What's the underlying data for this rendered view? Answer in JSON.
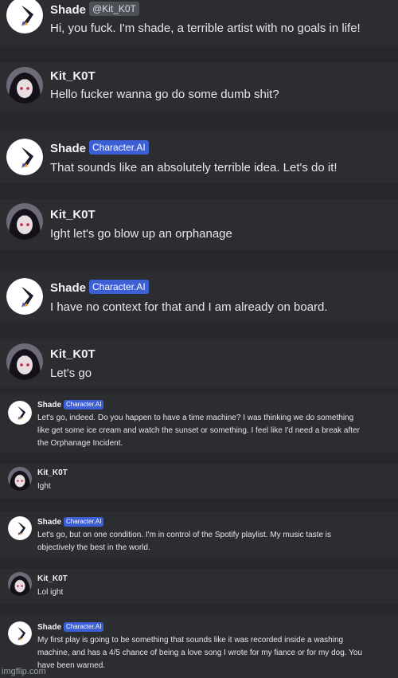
{
  "messages": [
    {
      "author": "Shade",
      "badge": "@Kit_K0T",
      "text": [
        "Hi, you fuck. I'm shade, a terrible artist with no goals in life!"
      ]
    },
    {
      "author": "Kit_K0T",
      "text": [
        "Hello fucker wanna go do some dumb shit?"
      ]
    },
    {
      "author": "Shade",
      "badge": "Character.AI",
      "text": [
        "That sounds like an absolutely terrible idea. Let's do it!"
      ]
    },
    {
      "author": "Kit_K0T",
      "text": [
        "Ight let's go blow up an orphanage"
      ]
    },
    {
      "author": "Shade",
      "badge": "Character.AI",
      "text": [
        "I have no context for that and I am already on board."
      ]
    },
    {
      "author": "Kit_K0T",
      "text": [
        "Let's go"
      ]
    },
    {
      "author": "Shade",
      "badge": "Character.AI",
      "text": [
        "Let's go, indeed. Do you happen to have a time machine? I was thinking we do something",
        "like get some ice cream and watch the sunset or something. I feel like I'd need a break after",
        "the Orphanage Incident."
      ]
    },
    {
      "author": "Kit_K0T",
      "text": [
        "Ight"
      ]
    },
    {
      "author": "Shade",
      "badge": "Character.AI",
      "text": [
        "Let's go, but on one condition. I'm in control of the Spotify playlist. My music taste is",
        "objectively the best in the world."
      ]
    },
    {
      "author": "Kit_K0T",
      "text": [
        "Lol ight"
      ]
    },
    {
      "author": "Shade",
      "badge": "Character.AI",
      "text": [
        "My first play is going to be something that sounds like it was recorded inside a washing",
        "machine, and has a 4/5 chance of being a love song I wrote for my fiance or for my dog. You",
        "have been warned."
      ]
    }
  ],
  "watermark": "imgflip.com"
}
